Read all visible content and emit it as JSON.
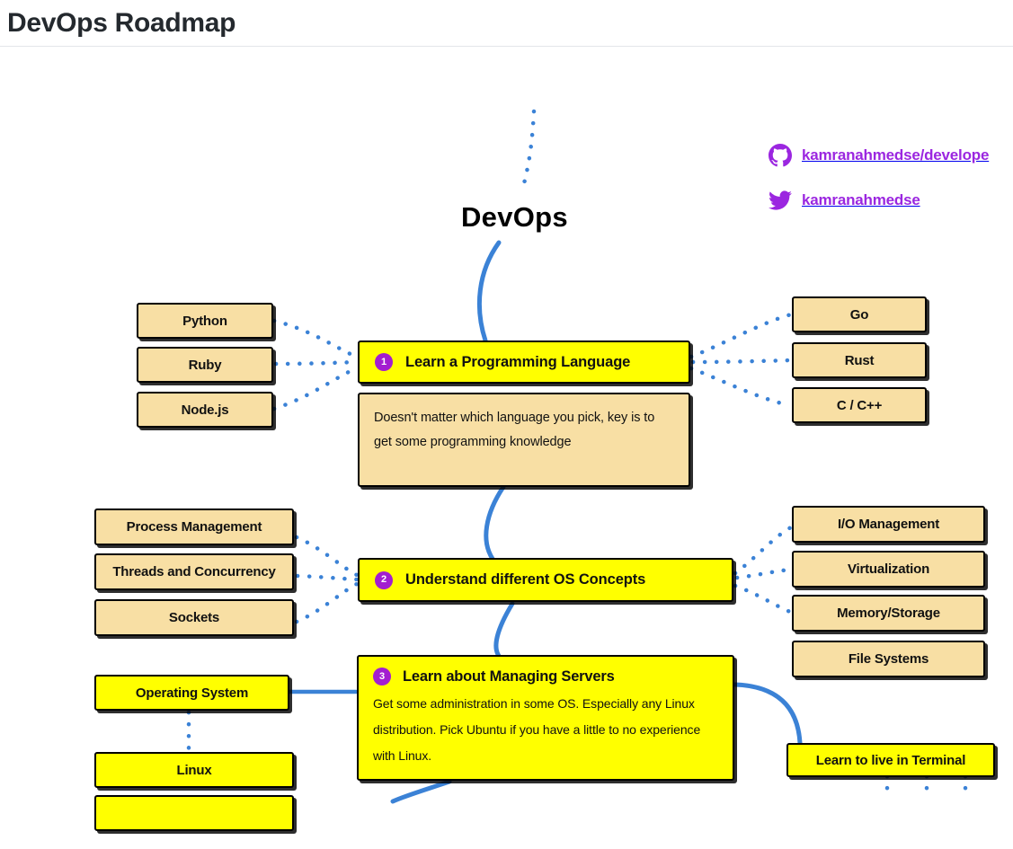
{
  "header": {
    "title": "DevOps Roadmap"
  },
  "social": [
    {
      "icon": "github-icon",
      "label": "kamranahmedse/develope"
    },
    {
      "icon": "twitter-icon",
      "label": "kamranahmedse"
    }
  ],
  "canvas": {
    "central_title": "DevOps"
  },
  "colors": {
    "primary_node": "#ffff00",
    "secondary_node": "#f8dfa4",
    "badge": "#a31ed0",
    "edge": "#3b82d6",
    "accent_text": "#9b26e0",
    "title_text": "#24292e"
  },
  "nodes": {
    "step1": {
      "number": "1",
      "label": "Learn a Programming Language",
      "description": "Doesn't matter which language you pick, key is to get some programming knowledge",
      "left_children": [
        "Python",
        "Ruby",
        "Node.js"
      ],
      "right_children": [
        "Go",
        "Rust",
        "C / C++"
      ]
    },
    "step2": {
      "number": "2",
      "label": "Understand different OS Concepts",
      "left_children": [
        "Process Management",
        "Threads and Concurrency",
        "Sockets"
      ],
      "right_children": [
        "I/O Management",
        "Virtualization",
        "Memory/Storage",
        "File Systems"
      ]
    },
    "step3": {
      "number": "3",
      "label": "Learn about Managing Servers",
      "description": "Get some administration in some OS. Especially any Linux distribution. Pick Ubuntu if you have a little to no experience with Linux.",
      "left_children": [
        "Operating System",
        "Linux"
      ],
      "right_children": [
        "Learn to live in Terminal"
      ]
    }
  }
}
